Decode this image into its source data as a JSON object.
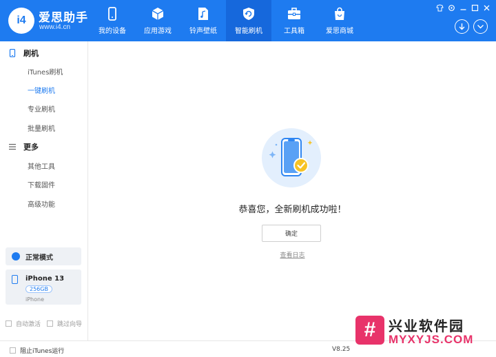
{
  "app": {
    "brand_name": "爱思助手",
    "brand_url": "www.i4.cn",
    "logo_text": "i4",
    "accent_color": "#1e7bf0"
  },
  "nav": {
    "items": [
      {
        "label": "我的设备",
        "icon": "apple-device-icon"
      },
      {
        "label": "应用游戏",
        "icon": "cube-icon"
      },
      {
        "label": "铃声壁纸",
        "icon": "music-file-icon"
      },
      {
        "label": "智能刷机",
        "icon": "refresh-shield-icon",
        "active": true
      },
      {
        "label": "工具箱",
        "icon": "toolbox-icon"
      },
      {
        "label": "爱思商城",
        "icon": "shopping-bag-icon"
      }
    ]
  },
  "sidebar": {
    "flash_title": "刷机",
    "flash_items": [
      {
        "label": "iTunes刷机"
      },
      {
        "label": "一键刷机",
        "active": true
      },
      {
        "label": "专业刷机"
      },
      {
        "label": "批量刷机"
      }
    ],
    "more_title": "更多",
    "more_items": [
      {
        "label": "其他工具"
      },
      {
        "label": "下载固件"
      },
      {
        "label": "高级功能"
      }
    ],
    "mode_label": "正常模式",
    "device_name": "iPhone 13",
    "device_storage": "256GB",
    "device_type": "iPhone",
    "auto_activate": "自动激活",
    "skip_guide": "跳过向导"
  },
  "main": {
    "success_message": "恭喜您，全新刷机成功啦！",
    "confirm_label": "确定",
    "view_log_label": "查看日志"
  },
  "footer": {
    "block_itunes_label": "阻止iTunes运行",
    "version": "V8.25"
  },
  "watermark": {
    "mark": "#",
    "title": "兴业软件园",
    "url": "MYXYJS.COM"
  }
}
